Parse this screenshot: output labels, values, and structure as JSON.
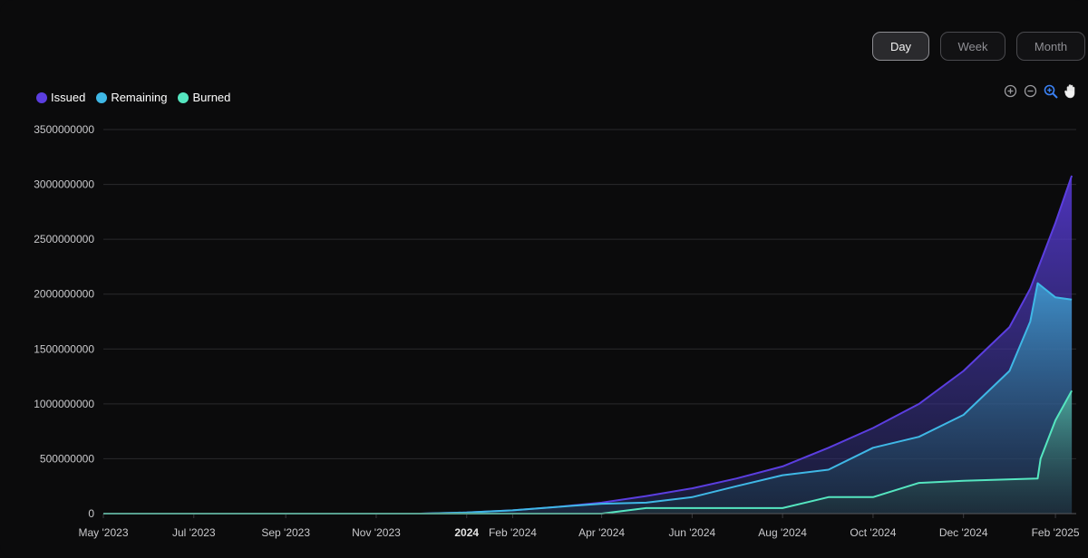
{
  "range_toggle": [
    {
      "label": "Day",
      "active": true
    },
    {
      "label": "Week",
      "active": false
    },
    {
      "label": "Month",
      "active": false
    }
  ],
  "toolbar": {
    "icons": [
      "zoom-in-icon",
      "zoom-out-icon",
      "selection-zoom-icon",
      "pan-hand-icon"
    ]
  },
  "colors": {
    "issued": "#5b3ee0",
    "remaining": "#3fb8e6",
    "burned": "#55e6c0",
    "background": "#0b0b0c",
    "grid": "#2a2a2d"
  },
  "chart_data": {
    "type": "area",
    "legend": {
      "position": "top-left"
    },
    "grid": true,
    "ylim": [
      0,
      3500000000
    ],
    "yticks": [
      "0",
      "500000000",
      "1000000000",
      "1500000000",
      "2000000000",
      "2500000000",
      "3000000000",
      "3500000000"
    ],
    "xticks": [
      {
        "label": "May '2023",
        "date": "2023-05-01"
      },
      {
        "label": "Jul '2023",
        "date": "2023-07-01"
      },
      {
        "label": "Sep '2023",
        "date": "2023-09-01"
      },
      {
        "label": "Nov '2023",
        "date": "2023-11-01"
      },
      {
        "label": "2024",
        "date": "2024-01-01",
        "bold": true
      },
      {
        "label": "Feb '2024",
        "date": "2024-02-01"
      },
      {
        "label": "Apr '2024",
        "date": "2024-04-01"
      },
      {
        "label": "Jun '2024",
        "date": "2024-06-01"
      },
      {
        "label": "Aug '2024",
        "date": "2024-08-01"
      },
      {
        "label": "Oct '2024",
        "date": "2024-10-01"
      },
      {
        "label": "Dec '2024",
        "date": "2024-12-01"
      },
      {
        "label": "Feb '2025",
        "date": "2025-02-01"
      }
    ],
    "xlim": [
      "2023-05-01",
      "2025-02-15"
    ],
    "series": [
      {
        "name": "Issued",
        "x": [
          "2023-05-01",
          "2023-12-01",
          "2024-01-01",
          "2024-02-01",
          "2024-03-01",
          "2024-04-01",
          "2024-05-01",
          "2024-06-01",
          "2024-07-01",
          "2024-08-01",
          "2024-09-01",
          "2024-10-01",
          "2024-11-01",
          "2024-12-01",
          "2025-01-01",
          "2025-01-15",
          "2025-02-01",
          "2025-02-12"
        ],
        "values": [
          0,
          0,
          10000000,
          30000000,
          60000000,
          100000000,
          160000000,
          230000000,
          320000000,
          430000000,
          600000000,
          780000000,
          1000000000,
          1300000000,
          1700000000,
          2050000000,
          2650000000,
          3080000000
        ]
      },
      {
        "name": "Remaining",
        "x": [
          "2023-05-01",
          "2023-12-01",
          "2024-01-01",
          "2024-02-01",
          "2024-03-01",
          "2024-04-01",
          "2024-05-01",
          "2024-06-01",
          "2024-07-01",
          "2024-08-01",
          "2024-09-01",
          "2024-10-01",
          "2024-11-01",
          "2024-12-01",
          "2025-01-01",
          "2025-01-15",
          "2025-01-20",
          "2025-02-01",
          "2025-02-12"
        ],
        "values": [
          0,
          0,
          10000000,
          30000000,
          60000000,
          90000000,
          100000000,
          150000000,
          250000000,
          350000000,
          400000000,
          600000000,
          700000000,
          900000000,
          1300000000,
          1750000000,
          2100000000,
          1970000000,
          1950000000
        ]
      },
      {
        "name": "Burned",
        "x": [
          "2023-05-01",
          "2024-04-01",
          "2024-05-01",
          "2024-08-01",
          "2024-09-01",
          "2024-10-01",
          "2024-11-01",
          "2024-12-01",
          "2025-01-20",
          "2025-01-22",
          "2025-02-01",
          "2025-02-12"
        ],
        "values": [
          0,
          0,
          50000000,
          50000000,
          150000000,
          150000000,
          280000000,
          300000000,
          320000000,
          500000000,
          850000000,
          1120000000
        ]
      }
    ]
  }
}
